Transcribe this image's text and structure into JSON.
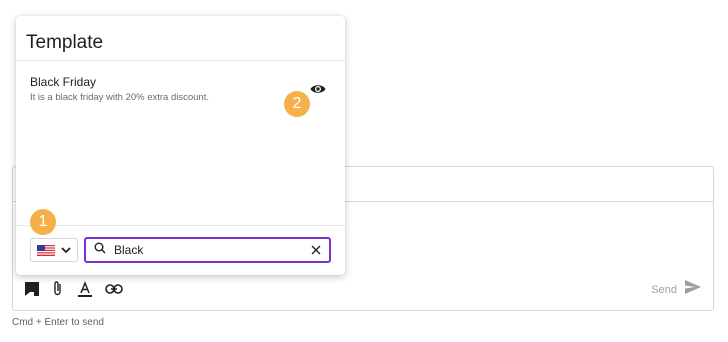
{
  "popup": {
    "title": "Template",
    "items": [
      {
        "title": "Black Friday",
        "description": "It is a black friday with 20% extra discount."
      }
    ],
    "preview_icon": "eye-icon"
  },
  "search": {
    "value": "Black"
  },
  "country_selector": {
    "flag": "us-flag-icon"
  },
  "badges": {
    "first": "1",
    "second": "2"
  },
  "composer": {
    "send_label": "Send"
  },
  "hint": "Cmd + Enter to send",
  "colors": {
    "badge": "#f6b04a",
    "search_border": "#7b2fd0"
  }
}
